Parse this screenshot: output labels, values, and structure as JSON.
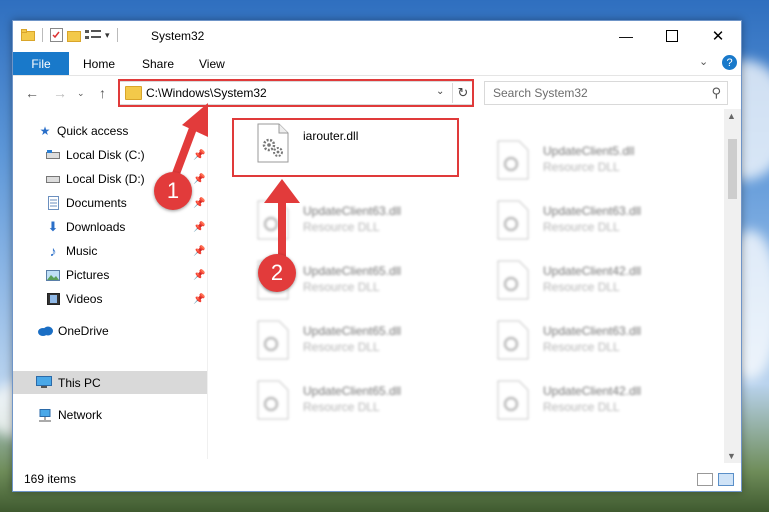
{
  "window": {
    "title": "System32",
    "ribbon_tabs": {
      "file": "File",
      "home": "Home",
      "share": "Share",
      "view": "View"
    }
  },
  "address": {
    "path": "C:\\Windows\\System32"
  },
  "search": {
    "placeholder": "Search System32"
  },
  "sidebar": {
    "quick_access": "Quick access",
    "local_c": "Local Disk (C:)",
    "local_d": "Local Disk (D:)",
    "documents": "Documents",
    "downloads": "Downloads",
    "music": "Music",
    "pictures": "Pictures",
    "videos": "Videos",
    "onedrive": "OneDrive",
    "this_pc": "This PC",
    "network": "Network"
  },
  "files": {
    "selected": {
      "name": "iarouter.dll"
    },
    "f01": {
      "name": "UpdateClient5.dll",
      "type": "Resource DLL"
    },
    "f02": {
      "name": "UpdateClient63.dll",
      "type": "Resource DLL"
    },
    "f03": {
      "name": "UpdateClient63.dll",
      "type": "Resource DLL"
    },
    "f04": {
      "name": "UpdateClient65.dll",
      "type": "Resource DLL"
    },
    "f05": {
      "name": "UpdateClient42.dll",
      "type": "Resource DLL"
    },
    "f06": {
      "name": "UpdateClient65.dll",
      "type": "Resource DLL"
    },
    "f07": {
      "name": "UpdateClient63.dll",
      "type": "Resource DLL"
    },
    "f08": {
      "name": "UpdateClient65.dll",
      "type": "Resource DLL"
    },
    "f09": {
      "name": "UpdateClient42.dll",
      "type": "Resource DLL"
    }
  },
  "status": {
    "items": "169 items"
  },
  "annotations": {
    "step1": "1",
    "step2": "2"
  },
  "colors": {
    "accent": "#1979ca",
    "highlight": "#e03a3a",
    "selected_nav": "#d9d9d9"
  }
}
